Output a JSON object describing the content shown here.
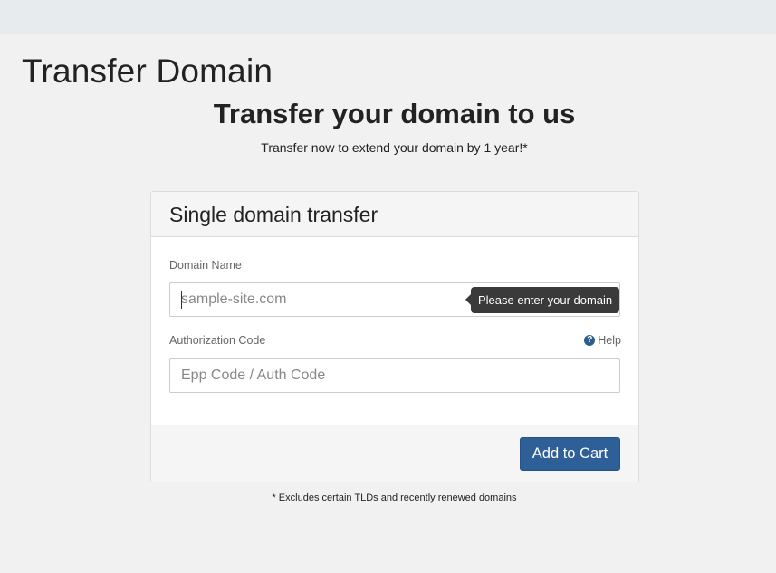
{
  "page": {
    "title": "Transfer Domain",
    "subtitle": "Transfer your domain to us",
    "tagline": "Transfer now to extend your domain by 1 year!*",
    "footnote": "* Excludes certain TLDs and recently renewed domains"
  },
  "panel": {
    "title": "Single domain transfer",
    "domain_field": {
      "label": "Domain Name",
      "placeholder": "sample-site.com",
      "value": "",
      "tooltip": "Please enter your domain"
    },
    "auth_field": {
      "label": "Authorization Code",
      "placeholder": "Epp Code / Auth Code",
      "value": "",
      "help_label": "Help",
      "help_icon": "question-circle-icon"
    },
    "submit_label": "Add to Cart"
  },
  "colors": {
    "primary_button": "#2e6097",
    "tooltip_bg": "#3a3a3a",
    "page_bg": "#f1f1f1"
  }
}
